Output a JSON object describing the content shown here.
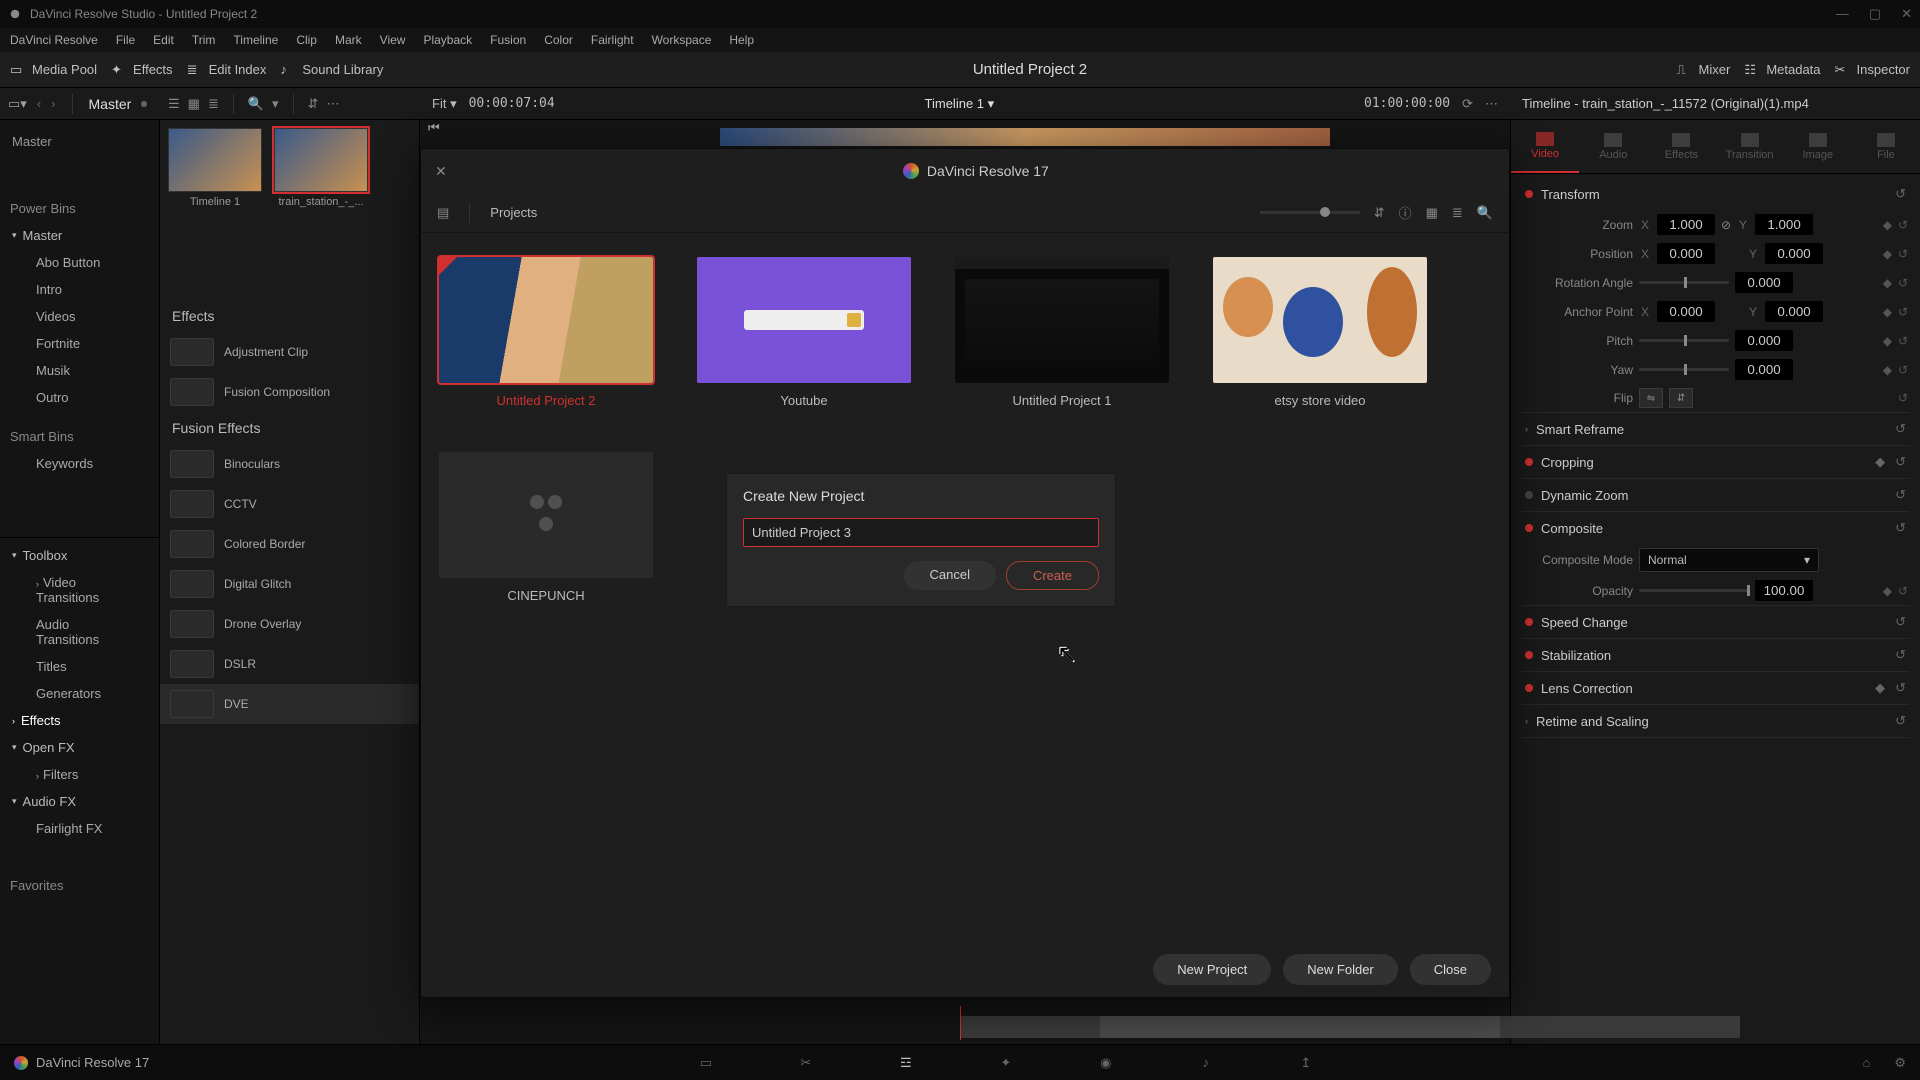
{
  "titlebar": {
    "title": "DaVinci Resolve Studio - Untitled Project 2"
  },
  "menu": [
    "DaVinci Resolve",
    "File",
    "Edit",
    "Trim",
    "Timeline",
    "Clip",
    "Mark",
    "View",
    "Playback",
    "Fusion",
    "Color",
    "Fairlight",
    "Workspace",
    "Help"
  ],
  "toolbar": {
    "media_pool": "Media Pool",
    "effects": "Effects",
    "edit_index": "Edit Index",
    "sound_library": "Sound Library",
    "center_title": "Untitled Project 2",
    "mixer": "Mixer",
    "metadata": "Metadata",
    "inspector": "Inspector"
  },
  "subheader": {
    "master": "Master",
    "fit": "Fit",
    "tc_left": "00:00:07:04",
    "timeline_name": "Timeline 1",
    "tc_right": "01:00:00:00",
    "inspector_title": "Timeline - train_station_-_11572 (Original)(1).mp4"
  },
  "sidebar": {
    "power_bins": "Power Bins",
    "master": "Master",
    "items": [
      "Abo Button",
      "Intro",
      "Videos",
      "Fortnite",
      "Musik",
      "Outro"
    ],
    "smart_bins": "Smart Bins",
    "keywords": "Keywords",
    "toolbox": "Toolbox",
    "toolbox_items": [
      "Video Transitions",
      "Audio Transitions",
      "Titles",
      "Generators"
    ],
    "effects": "Effects",
    "openfx": "Open FX",
    "filters": "Filters",
    "audiofx": "Audio FX",
    "fairlightfx": "Fairlight FX",
    "favorites": "Favorites"
  },
  "mediapool": {
    "master_label": "Master",
    "thumbs": [
      {
        "label": "Timeline 1"
      },
      {
        "label": "train_station_-_..."
      }
    ],
    "effects_hdr": "Effects",
    "effects": [
      "Adjustment Clip",
      "Fusion Composition"
    ],
    "fusion_hdr": "Fusion Effects",
    "fusion": [
      "Binoculars",
      "CCTV",
      "Colored Border",
      "Digital Glitch",
      "Drone Overlay",
      "DSLR",
      "DVE"
    ]
  },
  "inspector": {
    "tabs": [
      "Video",
      "Audio",
      "Effects",
      "Transition",
      "Image",
      "File"
    ],
    "active_tab": 0,
    "transform": {
      "label": "Transform",
      "zoom": "Zoom",
      "zoom_x": "1.000",
      "zoom_y": "1.000",
      "position": "Position",
      "pos_x": "0.000",
      "pos_y": "0.000",
      "rotation": "Rotation Angle",
      "rotation_v": "0.000",
      "anchor": "Anchor Point",
      "anchor_x": "0.000",
      "anchor_y": "0.000",
      "pitch": "Pitch",
      "pitch_v": "0.000",
      "yaw": "Yaw",
      "yaw_v": "0.000",
      "flip": "Flip"
    },
    "sections": [
      "Smart Reframe",
      "Cropping",
      "Dynamic Zoom",
      "Composite",
      "Speed Change",
      "Stabilization",
      "Lens Correction",
      "Retime and Scaling"
    ],
    "composite_mode": "Composite Mode",
    "composite_mode_v": "Normal",
    "opacity": "Opacity",
    "opacity_v": "100.00"
  },
  "pm": {
    "brand": "DaVinci Resolve 17",
    "crumb": "Projects",
    "cards": [
      {
        "label": "Untitled Project 2",
        "style": "woman",
        "sel": true
      },
      {
        "label": "Youtube",
        "style": "purple"
      },
      {
        "label": "Untitled Project 1",
        "style": "dark"
      },
      {
        "label": "etsy store video",
        "style": "etsy"
      },
      {
        "label": "CINEPUNCH",
        "style": "placeholder"
      }
    ],
    "footer": {
      "new_project": "New Project",
      "new_folder": "New Folder",
      "close": "Close"
    },
    "dialog": {
      "title": "Create New Project",
      "value": "Untitled Project 3",
      "cancel": "Cancel",
      "create": "Create"
    }
  },
  "bottom": {
    "appname": "DaVinci Resolve 17"
  }
}
